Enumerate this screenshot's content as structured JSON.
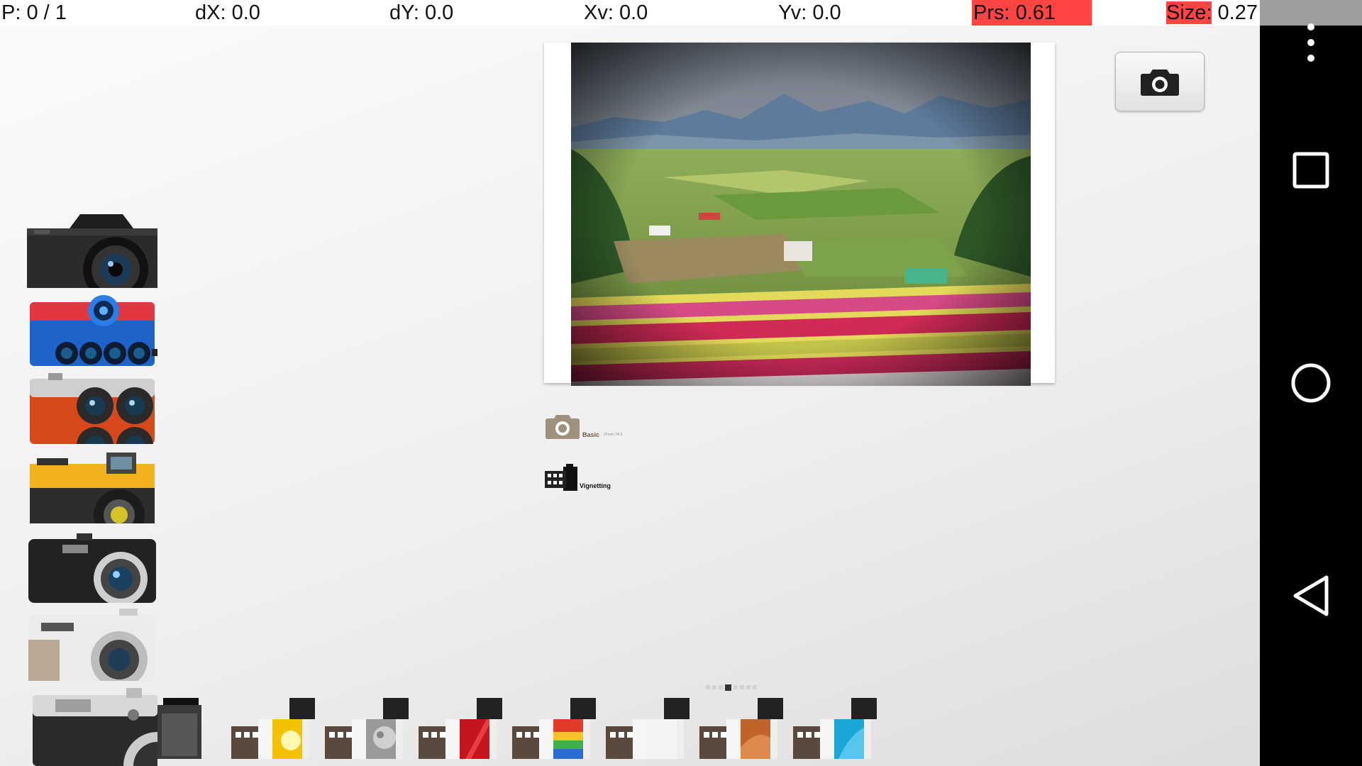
{
  "status": {
    "p": "P: 0 / 1",
    "dx": "dX: 0.0",
    "dy": "dY: 0.0",
    "xv": "Xv: 0.0",
    "yv": "Yv: 0.0",
    "prs": "Prs: 0.61",
    "size_label": "Size:",
    "size_value": " 0.27",
    "highlight_color": "#ff4444"
  },
  "navigation": {
    "icons": [
      "overflow-menu-icon",
      "recent-apps-icon",
      "home-icon",
      "back-icon"
    ]
  },
  "cameras": [
    {
      "name": "black-dslr"
    },
    {
      "name": "blue-multi-lens"
    },
    {
      "name": "orange-quad-lens"
    },
    {
      "name": "yellow-retro"
    },
    {
      "name": "black-compact"
    },
    {
      "name": "white-compact"
    },
    {
      "name": "silver-rangefinder"
    }
  ],
  "info": {
    "camera_label": "Basic",
    "camera_sub": "37mm / f4.3",
    "film_label": "Vignetting"
  },
  "pager": {
    "count": 8,
    "active": 3
  },
  "films": [
    {
      "name": "black-white",
      "color": "#555"
    },
    {
      "name": "sunburst",
      "color": "#f2c200"
    },
    {
      "name": "moon",
      "color": "#999"
    },
    {
      "name": "red",
      "color": "#c4161c"
    },
    {
      "name": "rainbow",
      "color": "#e23b2a"
    },
    {
      "name": "plain",
      "color": "#f4f4f4"
    },
    {
      "name": "copper",
      "color": "#c0642c"
    },
    {
      "name": "cyan",
      "color": "#1aa7d8"
    }
  ]
}
